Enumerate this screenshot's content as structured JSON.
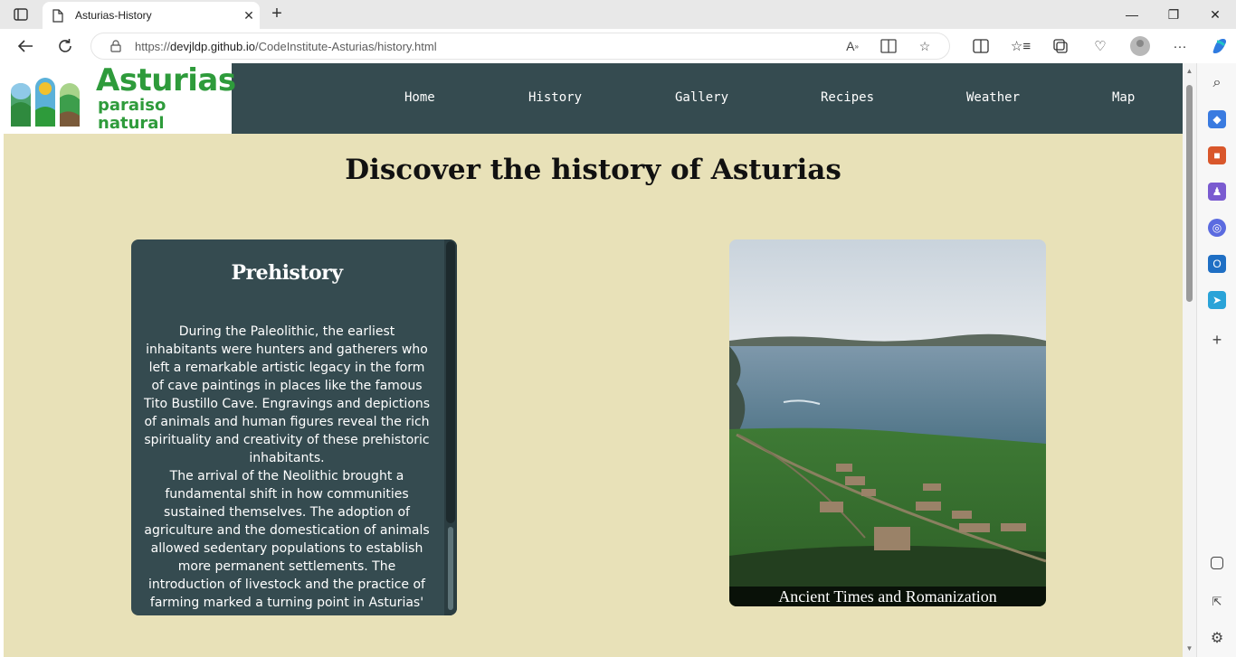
{
  "browser": {
    "tab_title": "Asturias-History",
    "url_prefix": "https://",
    "url_host": "devjldp.github.io",
    "url_path": "/CodeInstitute-Asturias/history.html"
  },
  "site": {
    "logo_title": "Asturias",
    "logo_subtitle": "paraiso natural",
    "nav": [
      "Home",
      "History",
      "Gallery",
      "Recipes",
      "Weather",
      "Map"
    ],
    "heading": "Discover the history of Asturias"
  },
  "card": {
    "title": "Prehistory",
    "paragraphs": [
      "During the Paleolithic, the earliest inhabitants were hunters and gatherers who left a remarkable artistic legacy in the form of cave paintings in places like the famous Tito Bustillo Cave. Engravings and depictions of animals and human figures reveal the rich spirituality and creativity of these prehistoric inhabitants.",
      "The arrival of the Neolithic brought a fundamental shift in how communities sustained themselves. The adoption of agriculture and the domestication of animals allowed sedentary populations to establish more permanent settlements. The introduction of livestock and the practice of farming marked a turning point in Asturias'"
    ]
  },
  "photo": {
    "caption": "Ancient Times and Romanization"
  },
  "colors": {
    "header_bg": "#354b50",
    "page_bg": "#e8e1b8",
    "logo_green": "#2e9b3b"
  }
}
